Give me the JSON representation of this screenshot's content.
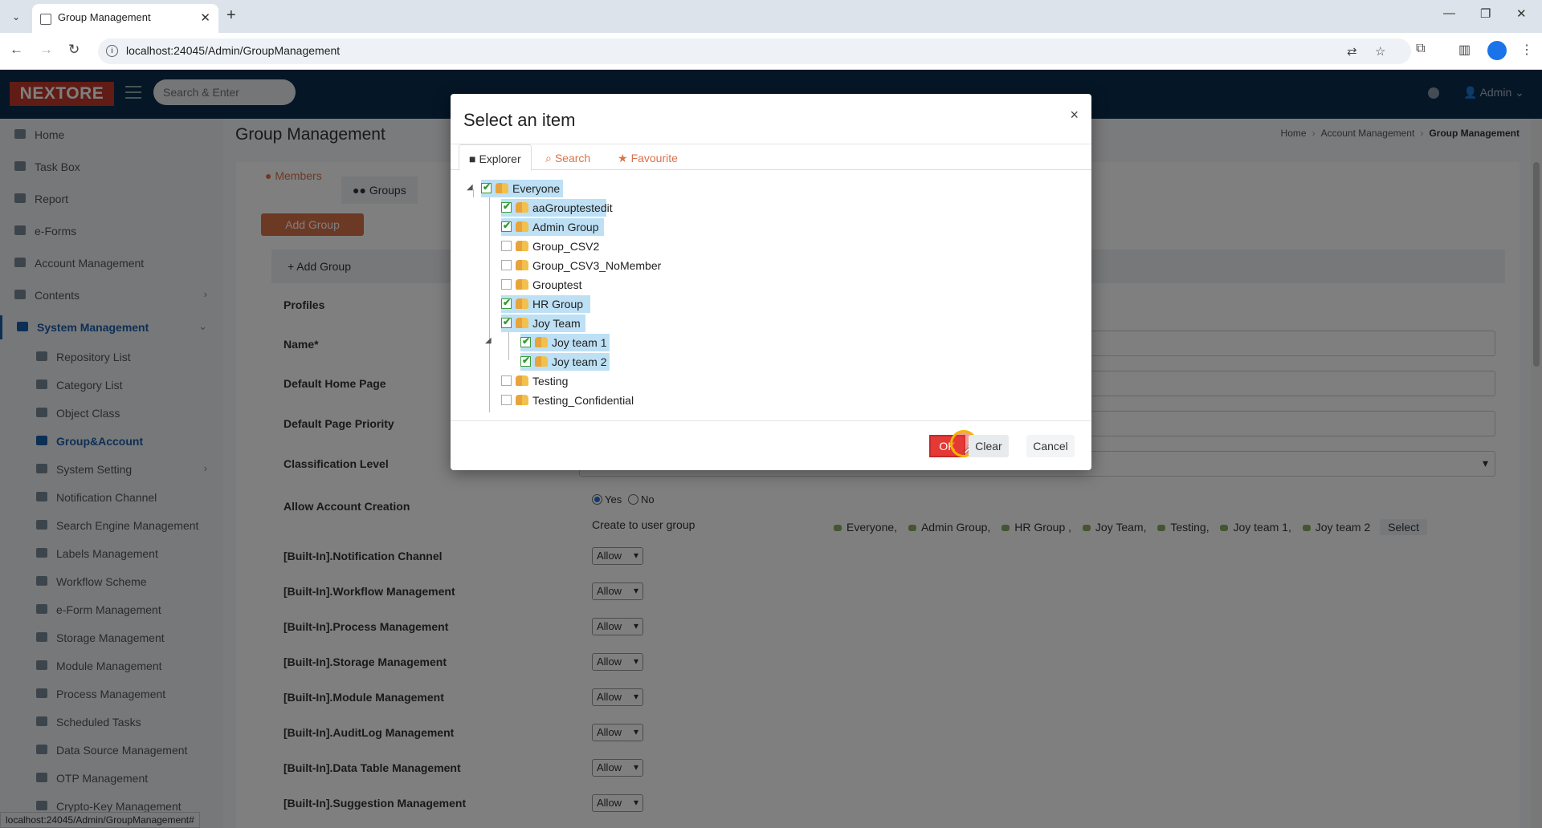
{
  "browser": {
    "tab_title": "Group Management",
    "url": "localhost:24045/Admin/GroupManagement",
    "status_url": "localhost:24045/Admin/GroupManagement#"
  },
  "app": {
    "logo": "NEXTORE",
    "search_placeholder": "Search & Enter",
    "user": "Admin"
  },
  "sidebar": {
    "items": [
      {
        "label": "Home",
        "icon": "home-icon"
      },
      {
        "label": "Task Box",
        "icon": "list-icon"
      },
      {
        "label": "Report",
        "icon": "table-icon"
      },
      {
        "label": "e-Forms",
        "icon": "form-icon"
      },
      {
        "label": "Account Management",
        "icon": "user-icon"
      },
      {
        "label": "Contents",
        "icon": "folder-icon"
      },
      {
        "label": "System Management",
        "icon": "gears-icon"
      }
    ],
    "subitems": [
      {
        "label": "Repository List"
      },
      {
        "label": "Category List"
      },
      {
        "label": "Object Class"
      },
      {
        "label": "Group&Account"
      },
      {
        "label": "System Setting"
      },
      {
        "label": "Notification Channel"
      },
      {
        "label": "Search Engine Management"
      },
      {
        "label": "Labels Management"
      },
      {
        "label": "Workflow Scheme"
      },
      {
        "label": "e-Form Management"
      },
      {
        "label": "Storage Management"
      },
      {
        "label": "Module Management"
      },
      {
        "label": "Process Management"
      },
      {
        "label": "Scheduled Tasks"
      },
      {
        "label": "Data Source Management"
      },
      {
        "label": "OTP Management"
      },
      {
        "label": "Crypto-Key Management"
      }
    ]
  },
  "page": {
    "title": "Group Management",
    "breadcrumb": [
      "Home",
      "Account Management",
      "Group Management"
    ],
    "tabs": [
      "Members",
      "Groups"
    ],
    "add_group_button": "Add Group",
    "form_header": "+ Add Group",
    "labels": {
      "profiles": "Profiles",
      "name": "Name*",
      "home_page": "Default Home Page",
      "priority": "Default Page Priority",
      "classification": "Classification Level",
      "allow_account": "Allow Account Creation"
    },
    "radio_yes": "Yes",
    "radio_no": "No",
    "create_to_group": "Create to user group",
    "selected_groups": [
      "Everyone,",
      "Admin Group,",
      "HR Group ,",
      "Joy Team,",
      "Testing,",
      "Joy team 1,",
      "Joy team 2"
    ],
    "select_button": "Select",
    "permissions": [
      {
        "label": "[Built-In].Notification Channel",
        "value": "Allow"
      },
      {
        "label": "[Built-In].Workflow Management",
        "value": "Allow"
      },
      {
        "label": "[Built-In].Process Management",
        "value": "Allow"
      },
      {
        "label": "[Built-In].Storage Management",
        "value": "Allow"
      },
      {
        "label": "[Built-In].Module Management",
        "value": "Allow"
      },
      {
        "label": "[Built-In].AuditLog Management",
        "value": "Allow"
      },
      {
        "label": "[Built-In].Data Table Management",
        "value": "Allow"
      },
      {
        "label": "[Built-In].Suggestion Management",
        "value": "Allow"
      }
    ]
  },
  "modal": {
    "title": "Select an item",
    "close": "×",
    "tabs": [
      "Explorer",
      "Search",
      "Favourite"
    ],
    "tree": [
      {
        "label": "Everyone",
        "checked": true,
        "level": 0
      },
      {
        "label": "aaGrouptestedit",
        "checked": true,
        "level": 1
      },
      {
        "label": "Admin Group",
        "checked": true,
        "level": 1
      },
      {
        "label": "Group_CSV2",
        "checked": false,
        "level": 1
      },
      {
        "label": "Group_CSV3_NoMember",
        "checked": false,
        "level": 1
      },
      {
        "label": "Grouptest",
        "checked": false,
        "level": 1
      },
      {
        "label": "HR Group",
        "checked": true,
        "level": 1
      },
      {
        "label": "Joy Team",
        "checked": true,
        "level": 1
      },
      {
        "label": "Joy team 1",
        "checked": true,
        "level": 2
      },
      {
        "label": "Joy team 2",
        "checked": true,
        "level": 2
      },
      {
        "label": "Testing",
        "checked": false,
        "level": 1
      },
      {
        "label": "Testing_Confidential",
        "checked": false,
        "level": 1
      }
    ],
    "ok": "OK",
    "clear": "Clear",
    "cancel": "Cancel"
  }
}
